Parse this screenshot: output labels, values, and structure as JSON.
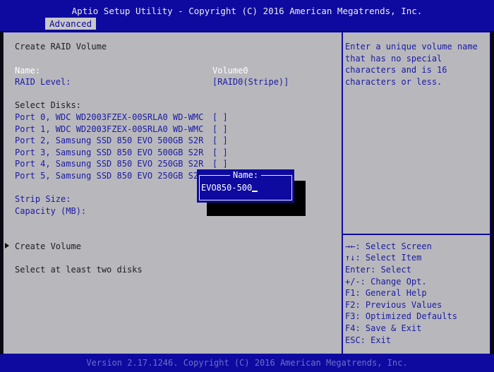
{
  "header": {
    "title": "Aptio Setup Utility - Copyright (C) 2016 American Megatrends, Inc.",
    "tab": "Advanced"
  },
  "main": {
    "section_title": "Create RAID Volume",
    "name_label": "Name:",
    "name_value": "Volume0",
    "raid_level_label": "RAID Level:",
    "raid_level_value": "[RAID0(Stripe)]",
    "select_disks_label": "Select Disks:",
    "disks": [
      {
        "label": "Port 0, WDC WD2003FZEX-00SRLA0 WD-WMC",
        "value": "[ ]"
      },
      {
        "label": "Port 1, WDC WD2003FZEX-00SRLA0 WD-WMC",
        "value": "[ ]"
      },
      {
        "label": "Port 2, Samsung SSD 850 EVO 500GB S2R",
        "value": "[ ]"
      },
      {
        "label": "Port 3, Samsung SSD 850 EVO 500GB S2R",
        "value": "[ ]"
      },
      {
        "label": "Port 4, Samsung SSD 850 EVO 250GB S2R",
        "value": "[ ]"
      },
      {
        "label": "Port 5, Samsung SSD 850 EVO 250GB S2R",
        "value": "[ ]"
      }
    ],
    "strip_size_label": "Strip Size:",
    "capacity_label": "Capacity (MB):",
    "create_volume": "Create Volume",
    "status_message": "Select at least two disks"
  },
  "popup": {
    "title": "Name:",
    "value": "EVO850-500"
  },
  "help": {
    "description": [
      "Enter a unique volume name",
      "that has no special",
      "characters and is 16",
      "characters or less."
    ],
    "keys": [
      "→←: Select Screen",
      "↑↓: Select Item",
      "Enter: Select",
      "+/-: Change Opt.",
      "F1: General Help",
      "F2: Previous Values",
      "F3: Optimized Defaults",
      "F4: Save & Exit",
      "ESC: Exit"
    ]
  },
  "footer": {
    "text": "Version 2.17.1246. Copyright (C) 2016 American Megatrends, Inc."
  },
  "colors": {
    "header_bg": "#0e0aa0",
    "panel_bg": "#b8b8bc",
    "accent_text": "#1a1aa6"
  }
}
